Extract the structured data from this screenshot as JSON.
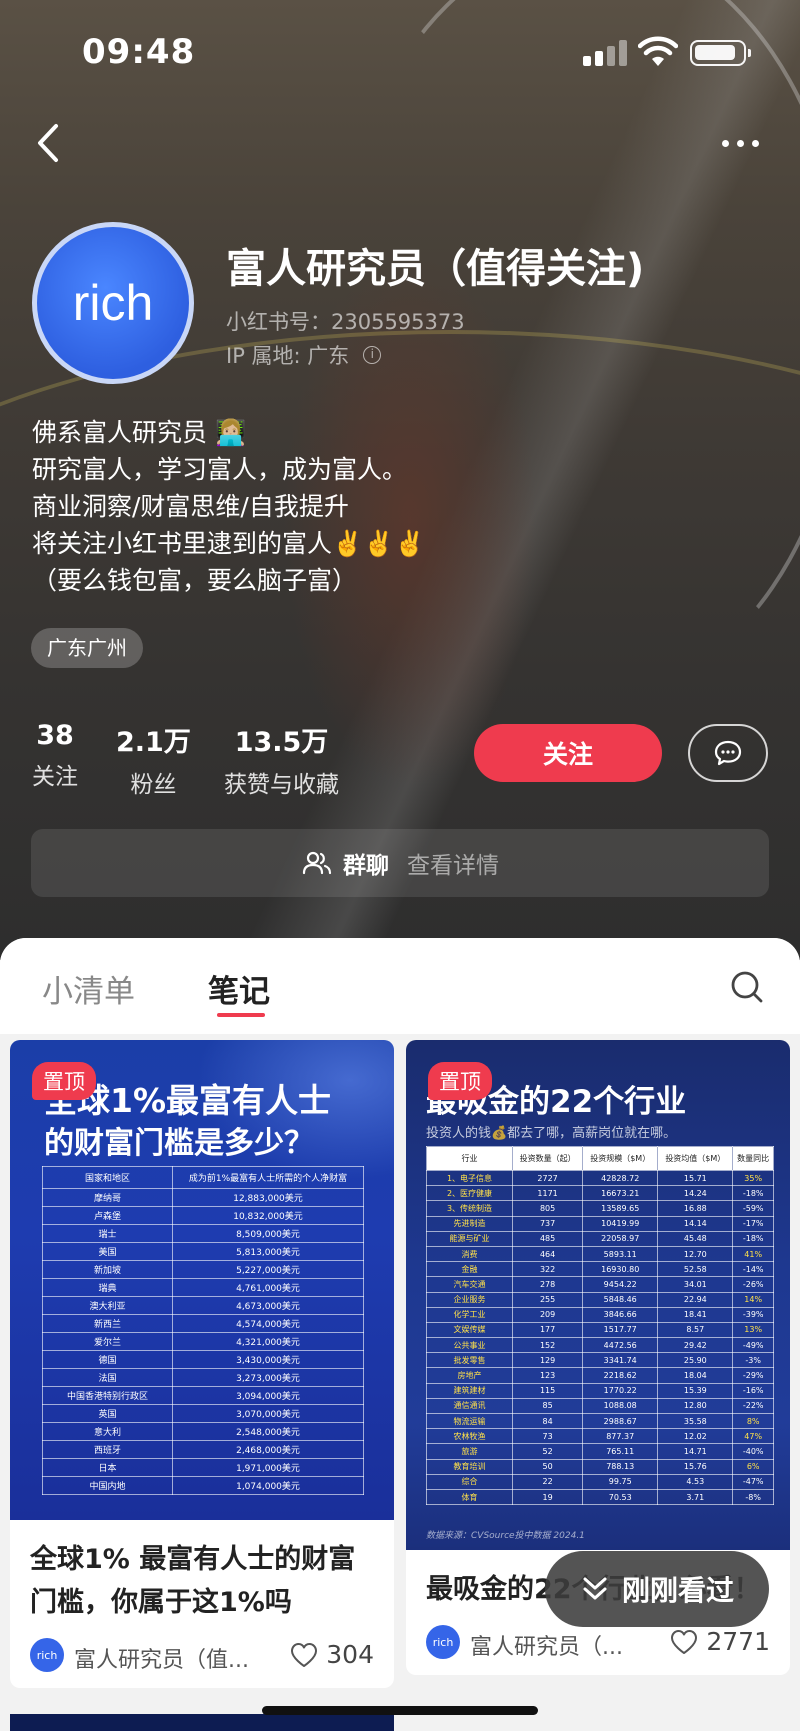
{
  "status_bar": {
    "time": "09:48"
  },
  "profile": {
    "avatar_text": "rich",
    "nickname": "富人研究员（值得关注)",
    "account_id": "小红书号：2305595373",
    "ip_location": "IP 属地: 广东",
    "bio_lines": [
      "佛系富人研究员 👩🏼‍💻",
      "研究富人，学习富人，成为富人。",
      "商业洞察/财富思维/自我提升",
      "将关注小红书里逮到的富人✌️✌️✌️",
      "（要么钱包富，要么脑子富）"
    ],
    "location_tag": "广东广州",
    "stats": [
      {
        "value": "38",
        "label": "关注"
      },
      {
        "value": "2.1万",
        "label": "粉丝"
      },
      {
        "value": "13.5万",
        "label": "获赞与收藏"
      }
    ],
    "follow_label": "关注",
    "group_chat": {
      "title": "群聊",
      "detail": "查看详情"
    }
  },
  "tabs": [
    {
      "label": "小清单",
      "active": false
    },
    {
      "label": "笔记",
      "active": true
    }
  ],
  "notes": [
    {
      "pinned_label": "置顶",
      "image_title_line1": "全球1%最富有人士",
      "image_title_line2": "的财富门槛是多少？",
      "table_headers": [
        "国家和地区",
        "成为前1%最富有人士所需的个人净财富"
      ],
      "table_rows": [
        [
          "摩纳哥",
          "12,883,000美元"
        ],
        [
          "卢森堡",
          "10,832,000美元"
        ],
        [
          "瑞士",
          "8,509,000美元"
        ],
        [
          "美国",
          "5,813,000美元"
        ],
        [
          "新加坡",
          "5,227,000美元"
        ],
        [
          "瑞典",
          "4,761,000美元"
        ],
        [
          "澳大利亚",
          "4,673,000美元"
        ],
        [
          "新西兰",
          "4,574,000美元"
        ],
        [
          "爱尔兰",
          "4,321,000美元"
        ],
        [
          "德国",
          "3,430,000美元"
        ],
        [
          "法国",
          "3,273,000美元"
        ],
        [
          "中国香港特别行政区",
          "3,094,000美元"
        ],
        [
          "英国",
          "3,070,000美元"
        ],
        [
          "意大利",
          "2,548,000美元"
        ],
        [
          "西班牙",
          "2,468,000美元"
        ],
        [
          "日本",
          "1,971,000美元"
        ],
        [
          "中国内地",
          "1,074,000美元"
        ]
      ],
      "title": "全球1% 最富有人士的财富门槛，你属于这1%吗",
      "author": "富人研究员（值...",
      "likes": "304"
    },
    {
      "pinned_label": "置顶",
      "image_title": "最吸金的22个行业",
      "image_subtitle": "投资人的钱💰都去了哪，高薪岗位就在哪。",
      "table_headers": [
        "行业",
        "投资数量（起）",
        "投资规模（$M）",
        "投资均值（$M）",
        "数量同比"
      ],
      "table_rows": [
        [
          "1、电子信息",
          "2727",
          "42828.72",
          "15.71",
          "35%"
        ],
        [
          "2、医疗健康",
          "1171",
          "16673.21",
          "14.24",
          "-18%"
        ],
        [
          "3、传统制造",
          "805",
          "13589.65",
          "16.88",
          "-59%"
        ],
        [
          "先进制造",
          "737",
          "10419.99",
          "14.14",
          "-17%"
        ],
        [
          "能源与矿业",
          "485",
          "22058.97",
          "45.48",
          "-18%"
        ],
        [
          "消费",
          "464",
          "5893.11",
          "12.70",
          "41%"
        ],
        [
          "金融",
          "322",
          "16930.80",
          "52.58",
          "-14%"
        ],
        [
          "汽车交通",
          "278",
          "9454.22",
          "34.01",
          "-26%"
        ],
        [
          "企业服务",
          "255",
          "5848.46",
          "22.94",
          "14%"
        ],
        [
          "化学工业",
          "209",
          "3846.66",
          "18.41",
          "-39%"
        ],
        [
          "文娱传媒",
          "177",
          "1517.77",
          "8.57",
          "13%"
        ],
        [
          "公共事业",
          "152",
          "4472.56",
          "29.42",
          "-49%"
        ],
        [
          "批发零售",
          "129",
          "3341.74",
          "25.90",
          "-3%"
        ],
        [
          "房地产",
          "123",
          "2218.62",
          "18.04",
          "-29%"
        ],
        [
          "建筑建材",
          "115",
          "1770.22",
          "15.39",
          "-16%"
        ],
        [
          "通信通讯",
          "85",
          "1088.08",
          "12.80",
          "-22%"
        ],
        [
          "物流运输",
          "84",
          "2988.67",
          "35.58",
          "8%"
        ],
        [
          "农林牧渔",
          "73",
          "877.37",
          "12.02",
          "47%"
        ],
        [
          "旅游",
          "52",
          "765.11",
          "14.71",
          "-40%"
        ],
        [
          "教育培训",
          "50",
          "788.13",
          "15.76",
          "6%"
        ],
        [
          "综合",
          "22",
          "99.75",
          "4.53",
          "-47%"
        ],
        [
          "体育",
          "19",
          "70.53",
          "3.71",
          "-8%"
        ]
      ],
      "source": "数据来源：CVSource投中数据 2024.1",
      "title": "最吸金的22个行业，必看！",
      "author": "富人研究员（...",
      "likes": "2771"
    }
  ],
  "recently_viewed_label": "刚刚看过",
  "colors": {
    "accent": "#ef3b4e",
    "avatar_blue": "#3565e8",
    "card_navy": "#0f2a7a"
  }
}
